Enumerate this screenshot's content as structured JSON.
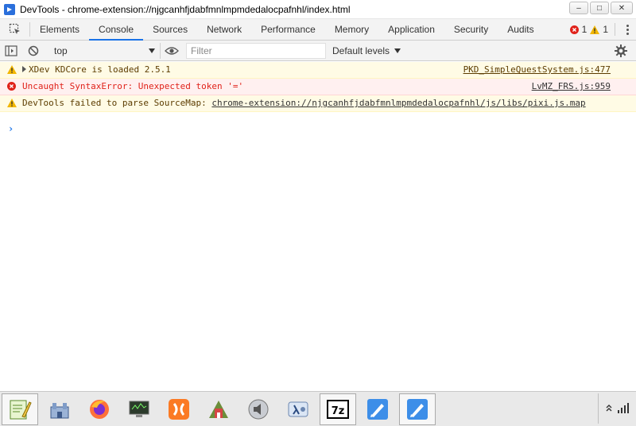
{
  "window": {
    "title": "DevTools - chrome-extension://njgcanhfjdabfmnlmpmdedalocpafnhl/index.html",
    "minimize_glyph": "–",
    "maximize_glyph": "□",
    "close_glyph": "✕"
  },
  "tabs": [
    {
      "label": "Elements"
    },
    {
      "label": "Console",
      "active": true
    },
    {
      "label": "Sources"
    },
    {
      "label": "Network"
    },
    {
      "label": "Performance"
    },
    {
      "label": "Memory"
    },
    {
      "label": "Application"
    },
    {
      "label": "Security"
    },
    {
      "label": "Audits"
    }
  ],
  "counts": {
    "errors": "1",
    "warnings": "1"
  },
  "toolbar": {
    "context": "top",
    "filter_placeholder": "Filter",
    "filter_value": "",
    "levels": "Default levels"
  },
  "messages": [
    {
      "type": "warning",
      "text": "XDev KDCore is loaded 2.5.1",
      "source": "PKD_SimpleQuestSystem.js:477",
      "expandable": true
    },
    {
      "type": "error",
      "text": "Uncaught SyntaxError: Unexpected token '='",
      "source": "LvMZ_FRS.js:959"
    },
    {
      "type": "warning",
      "text": "DevTools failed to parse SourceMap: ",
      "link": "chrome-extension://njgcanhfjdabfmnlmpmdedalocpafnhl/js/libs/pixi.js.map"
    }
  ],
  "prompt": "›",
  "taskbar": {
    "apps": [
      "notepad-plus-plus-icon",
      "castle-app-icon",
      "firefox-icon",
      "monitor-app-icon",
      "xampp-icon",
      "rpg-maker-icon",
      "audio-speaker-icon",
      "lambda-app-icon",
      "7zip-icon",
      "pencil-app-icon",
      "pencil-app-icon-2"
    ],
    "tray_arrow": "≈"
  },
  "colors": {
    "accent": "#1a73e8",
    "error": "#e0221a",
    "warning": "#f2b600",
    "warning_bg": "#fffbe5",
    "error_bg": "#fff0f0"
  }
}
